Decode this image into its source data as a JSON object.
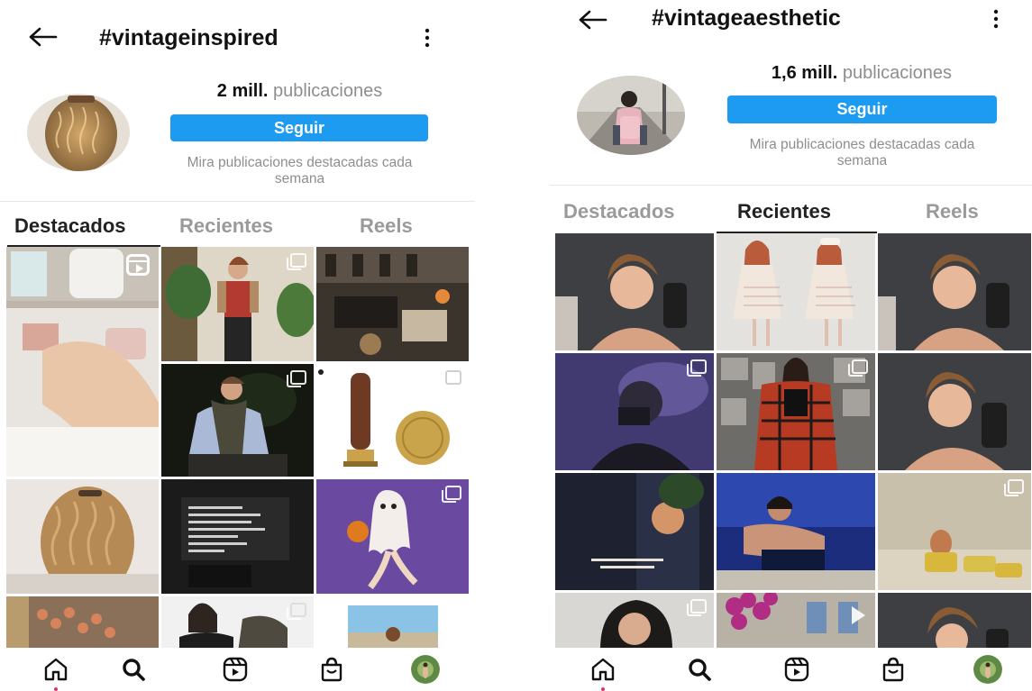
{
  "screens": {
    "left": {
      "title": "#vintageinspired",
      "post_count": "2 mill.",
      "post_unit": "publicaciones",
      "follow_label": "Seguir",
      "featured_text": "Mira publicaciones destacadas cada semana",
      "tabs": [
        {
          "label": "Destacados",
          "active": true
        },
        {
          "label": "Recientes",
          "active": false
        },
        {
          "label": "Reels",
          "active": false
        }
      ]
    },
    "right": {
      "title": "#vintageaesthetic",
      "post_count": "1,6 mill.",
      "post_unit": "publicaciones",
      "follow_label": "Seguir",
      "featured_text": "Mira publicaciones destacadas cada semana",
      "tabs": [
        {
          "label": "Destacados",
          "active": false
        },
        {
          "label": "Recientes",
          "active": true
        },
        {
          "label": "Reels",
          "active": false
        }
      ]
    }
  },
  "icons": {
    "back": "arrow-left-icon",
    "more": "vertical-dots-icon",
    "multi_post": "carousel-icon",
    "reel": "reel-icon",
    "nav": [
      "home-icon",
      "search-icon",
      "reels-icon",
      "shop-icon",
      "profile-avatar"
    ]
  },
  "colors": {
    "follow_button": "#1d9bf0",
    "muted_text": "#8e8e8e",
    "active_text": "#222222"
  }
}
